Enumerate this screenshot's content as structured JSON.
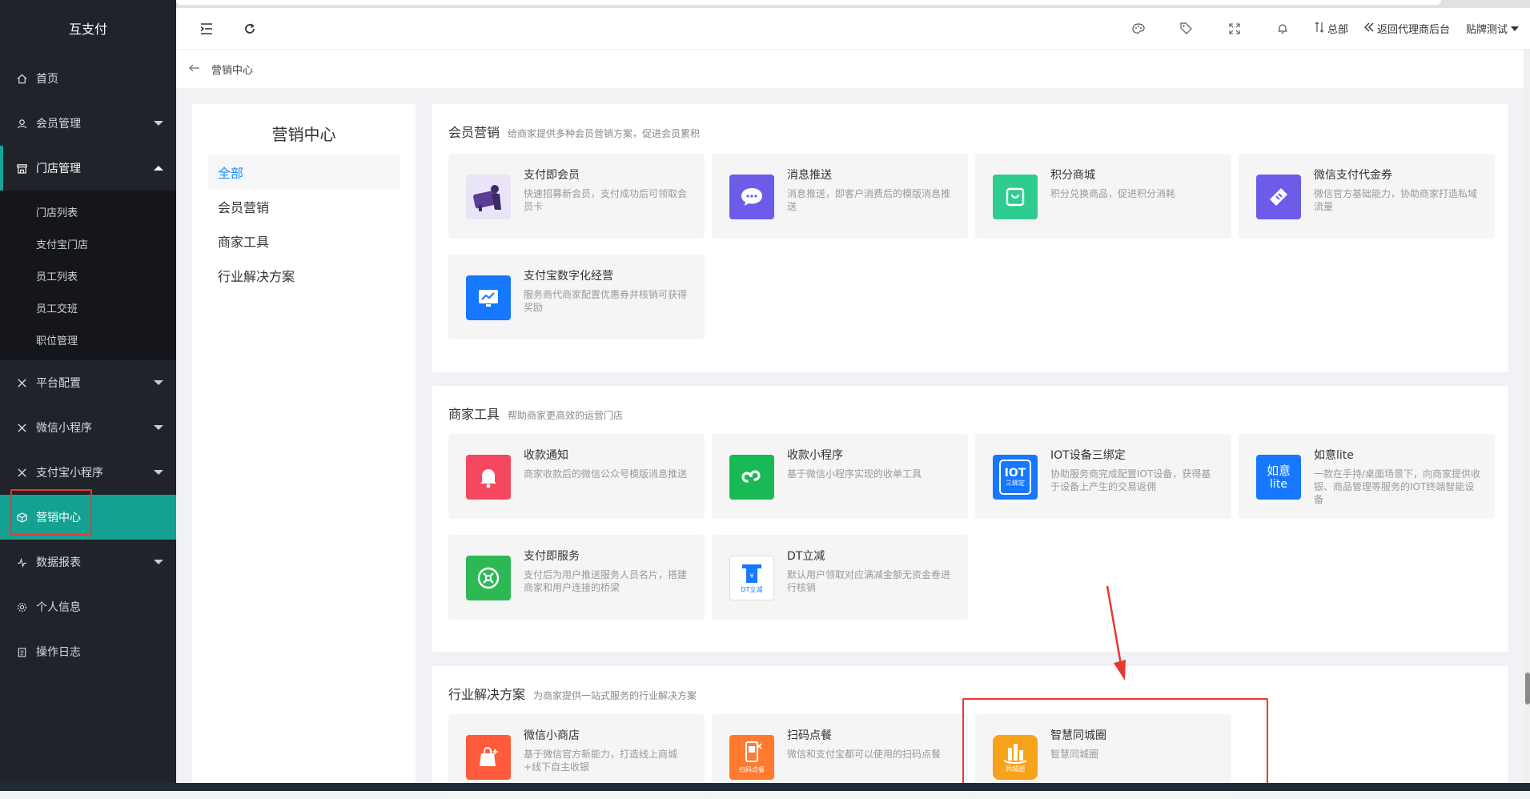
{
  "app": {
    "title": "互支付"
  },
  "sidebar": {
    "items": [
      {
        "label": "首页",
        "icon": "home-icon"
      },
      {
        "label": "会员管理",
        "icon": "user-icon"
      },
      {
        "label": "门店管理",
        "icon": "store-icon"
      },
      {
        "label": "平台配置",
        "icon": "tools-icon"
      },
      {
        "label": "微信小程序",
        "icon": "tools-icon"
      },
      {
        "label": "支付宝小程序",
        "icon": "tools-icon"
      },
      {
        "label": "营销中心",
        "icon": "cube-icon"
      },
      {
        "label": "数据报表",
        "icon": "pulse-icon"
      },
      {
        "label": "个人信息",
        "icon": "gear-icon"
      },
      {
        "label": "操作日志",
        "icon": "clipboard-icon"
      }
    ],
    "submenu": [
      "门店列表",
      "支付宝门店",
      "员工列表",
      "员工交班",
      "职位管理"
    ]
  },
  "header": {
    "general": "总部",
    "back_to_agent": "返回代理商后台",
    "user": "贴牌测试"
  },
  "breadcrumb": {
    "label": "营销中心"
  },
  "left_panel": {
    "title": "营销中心",
    "items": [
      "全部",
      "会员营销",
      "商家工具",
      "行业解决方案"
    ]
  },
  "sections": [
    {
      "title": "会员营销",
      "desc": "给商家提供多种会员营销方案，促进会员累积",
      "cards": [
        {
          "title": "支付即会员",
          "desc": "快速招募新会员，支付成功后可领取会员卡"
        },
        {
          "title": "消息推送",
          "desc": "消息推送，即客户消费后的模版消息推送"
        },
        {
          "title": "积分商城",
          "desc": "积分兑换商品，促进积分消耗"
        },
        {
          "title": "微信支付代金券",
          "desc": "微信官方基础能力，协助商家打造私域流量"
        },
        {
          "title": "支付宝数字化经营",
          "desc": "服务商代商家配置优惠券并核销可获得奖励"
        }
      ]
    },
    {
      "title": "商家工具",
      "desc": "帮助商家更高效的运营门店",
      "cards": [
        {
          "title": "收款通知",
          "desc": "商家收款后的微信公众号模版消息推送"
        },
        {
          "title": "收款小程序",
          "desc": "基于微信小程序实现的收单工具"
        },
        {
          "title": "IOT设备三绑定",
          "desc": "协助服务商完成配置IOT设备，获得基于设备上产生的交易返佣",
          "icon_text": "IOT",
          "icon_sub": "三绑定"
        },
        {
          "title": "如意lite",
          "desc": "一款在手持/桌面场景下，向商家提供收银、商品管理等服务的IOT终端智能设备",
          "icon_text": "如意",
          "icon_sub": "lite"
        },
        {
          "title": "支付即服务",
          "desc": "支付后为用户推送服务人员名片，搭建商家和用户连接的桥梁"
        },
        {
          "title": "DT立减",
          "desc": "默认用户领取对应满减金额无资金卷进行核销",
          "icon_sub": "DT立减"
        }
      ]
    },
    {
      "title": "行业解决方案",
      "desc": "为商家提供一站式服务的行业解决方案",
      "cards": [
        {
          "title": "微信小商店",
          "desc": "基于微信官方新能力，打造线上商城+线下自主收银"
        },
        {
          "title": "扫码点餐",
          "desc": "微信和支付宝都可以使用的扫码点餐",
          "icon_sub": "扫码点餐"
        },
        {
          "title": "智慧同城圈",
          "desc": "智慧同城圈",
          "icon_sub": "同城圈"
        }
      ]
    }
  ],
  "colors": {
    "sidebar_bg": "#20232a",
    "active_teal": "#15a192",
    "link_blue": "#1890ff",
    "highlight_red": "#e53935"
  }
}
